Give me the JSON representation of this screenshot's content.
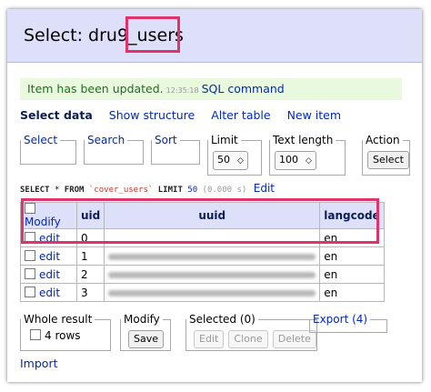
{
  "header": {
    "title": "Select: dru9_users"
  },
  "message": {
    "text": "Item has been updated.",
    "time": "12:35:18",
    "link": "SQL command"
  },
  "links": {
    "select_data": "Select data",
    "show_structure": "Show structure",
    "alter_table": "Alter table",
    "new_item": "New item"
  },
  "filters": {
    "select": "Select",
    "search": "Search",
    "sort": "Sort",
    "limit": {
      "label": "Limit",
      "value": "50"
    },
    "text_length": {
      "label": "Text length",
      "value": "100"
    },
    "action": {
      "label": "Action",
      "button": "Select"
    }
  },
  "query": {
    "select": "SELECT",
    "star": "*",
    "from": "FROM",
    "table": "`cover_users`",
    "limit": "LIMIT",
    "limit_value": "50",
    "duration": "(0.000 s)",
    "edit": "Edit"
  },
  "table": {
    "headers": {
      "modify": "Modify",
      "uid": "uid",
      "uuid": "uuid",
      "langcode": "langcode"
    },
    "rows": [
      {
        "link": "edit",
        "uid": "0",
        "langcode": "en"
      },
      {
        "link": "edit",
        "uid": "1",
        "langcode": "en"
      },
      {
        "link": "edit",
        "uid": "2",
        "langcode": "en"
      },
      {
        "link": "edit",
        "uid": "3",
        "langcode": "en"
      }
    ]
  },
  "bottom": {
    "whole_result": {
      "label": "Whole result",
      "rows": "4 rows"
    },
    "modify": {
      "label": "Modify",
      "button": "Save"
    },
    "selected": {
      "label": "Selected (0)",
      "edit": "Edit",
      "clone": "Clone",
      "delete": "Delete"
    },
    "export": "Export (4)"
  },
  "import": "Import",
  "colors": {
    "header_bg": "#dde0f8",
    "success_bg": "#e9f9de",
    "link": "#0029b8",
    "highlight": "#e0336b"
  }
}
